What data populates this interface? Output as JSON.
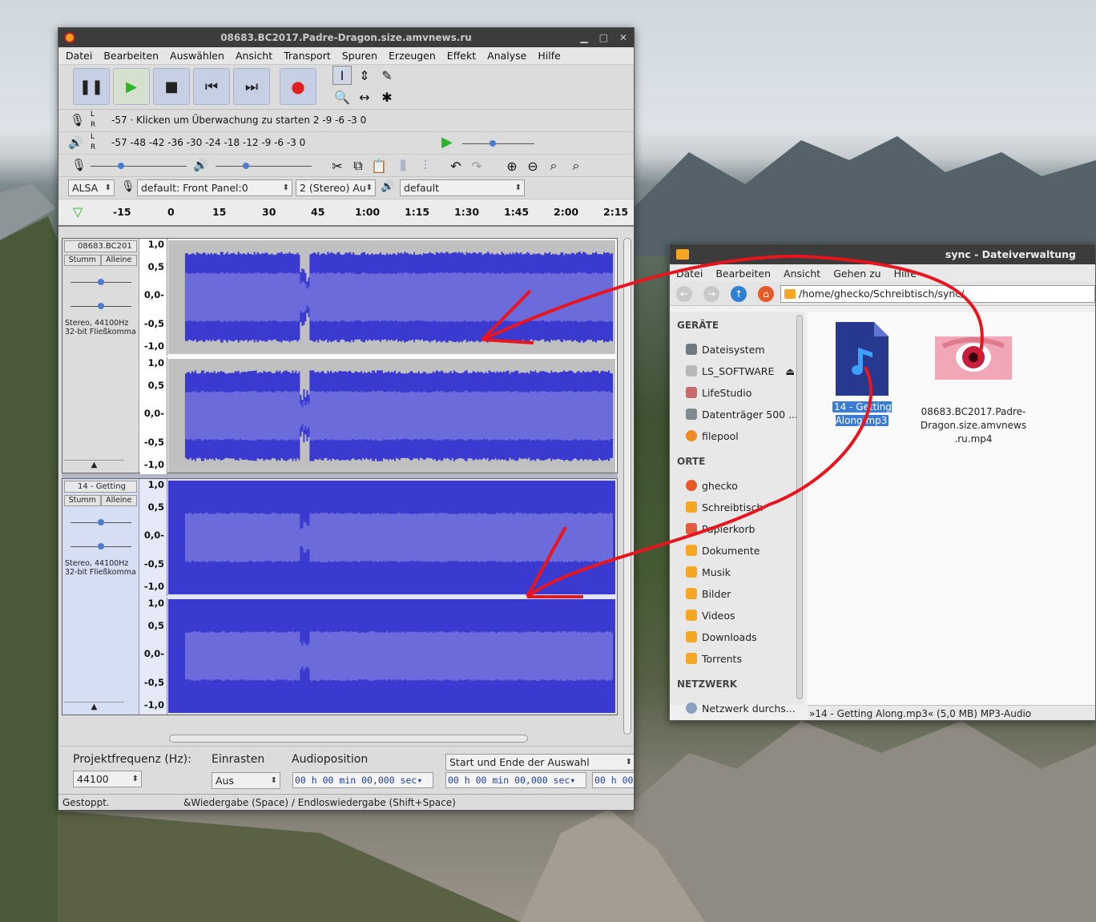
{
  "audacity": {
    "title": "08683.BC2017.Padre-Dragon.size.amvnews.ru",
    "menu": [
      "Datei",
      "Bearbeiten",
      "Auswählen",
      "Ansicht",
      "Transport",
      "Spuren",
      "Erzeugen",
      "Effekt",
      "Analyse",
      "Hilfe"
    ],
    "meter_rec_scale": "-57          ·  Klicken um Überwachung zu starten 2 -9  -6  -3  0",
    "meter_play_scale": "-57        -48     -42     -36     -30     -24     -18     -12 -9  -6  -3  0",
    "host": "ALSA",
    "rec_device": "default: Front Panel:0",
    "channels": "2 (Stereo) Au",
    "play_device": "default",
    "timeline_ticks": [
      "-15",
      "0",
      "15",
      "30",
      "45",
      "1:00",
      "1:15",
      "1:30",
      "1:45",
      "2:00",
      "2:15"
    ],
    "lr": [
      "L",
      "R"
    ],
    "track1": {
      "name": "08683.BC201",
      "mute": "Stumm",
      "solo": "Alleine",
      "info1": "Stereo, 44100Hz",
      "info2": "32-bit Fließkomma"
    },
    "track2": {
      "name": "14 - Getting",
      "mute": "Stumm",
      "solo": "Alleine",
      "info1": "Stereo, 44100Hz",
      "info2": "32-bit Fließkomma"
    },
    "ruler": [
      "1,0",
      "0,5",
      "0,0-",
      "-0,5",
      "-1,0"
    ],
    "selection": {
      "rate_label": "Projektfrequenz (Hz):",
      "rate_value": "44100",
      "snap_label": "Einrasten",
      "snap_value": "Aus",
      "pos_label": "Audioposition",
      "sel_label": "Start und Ende der Auswahl",
      "tc1": "00 h 00 min 00,000 sec▾",
      "tc2": "00 h 00 min 00,000 sec▾",
      "tc3": "00 h 00"
    },
    "status_left": "Gestoppt.",
    "status_right": "&Wiedergabe (Space) / Endloswiedergabe (Shift+Space)"
  },
  "filemanager": {
    "title": "sync - Dateiverwaltung",
    "menu": [
      "Datei",
      "Bearbeiten",
      "Ansicht",
      "Gehen zu",
      "Hilfe"
    ],
    "path": "/home/ghecko/Schreibtisch/sync/",
    "sections": {
      "devices": "GERÄTE",
      "places": "ORTE",
      "network": "NETZWERK"
    },
    "devices": [
      "Dateisystem",
      "LS_SOFTWARE",
      "LifeStudio",
      "Datenträger 500 ...",
      "filepool"
    ],
    "places": [
      "ghecko",
      "Schreibtisch",
      "Papierkorb",
      "Dokumente",
      "Musik",
      "Bilder",
      "Videos",
      "Downloads",
      "Torrents"
    ],
    "network": [
      "Netzwerk durchs..."
    ],
    "file1": {
      "line1": "14 - Getting",
      "line2": "Along.mp3"
    },
    "file2": {
      "line1": "08683.BC2017.Padre-",
      "line2": "Dragon.size.amvnews",
      "line3": ".ru.mp4"
    },
    "status": "»14 - Getting Along.mp3« (5,0 MB) MP3-Audio"
  },
  "colors": {
    "wave_dark": "#3a3ad0",
    "wave_light": "#6b6bdc",
    "accent": "#3a7bd5",
    "arrow": "#e8141e"
  }
}
